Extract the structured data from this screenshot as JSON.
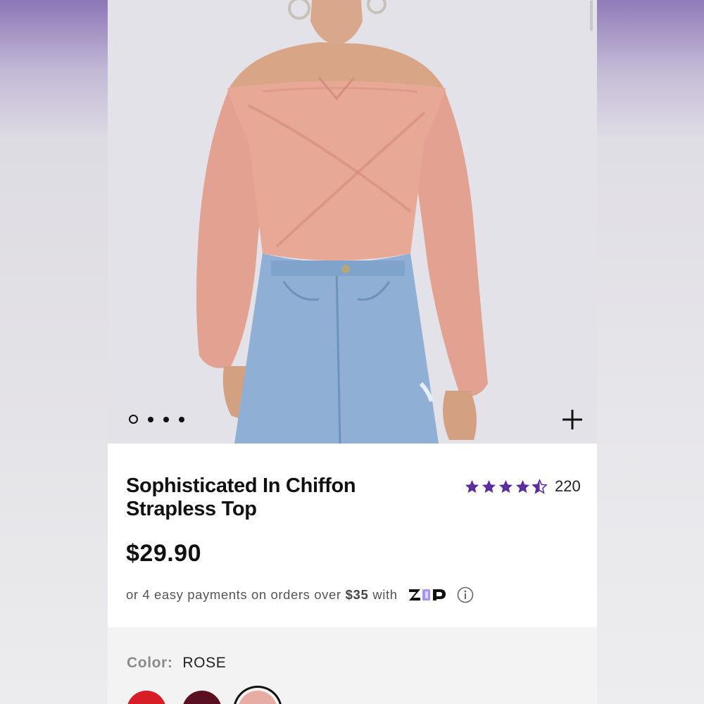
{
  "product": {
    "title": "Sophisticated In Chiffon Strapless Top",
    "rating": {
      "stars": 4.5,
      "max_stars": 5,
      "count": "220",
      "star_color": "#5a2e9c"
    },
    "price": "$29.90",
    "payments": {
      "text_before": "or 4 easy payments on orders over",
      "threshold": "$35",
      "text_after": "with",
      "provider_logo": "ZIP"
    },
    "gallery": {
      "total_images": 4,
      "active_index": 0
    },
    "color": {
      "label": "Color:",
      "selected": "ROSE",
      "swatches": [
        {
          "name": "red",
          "hex": "#d71e26"
        },
        {
          "name": "burgundy",
          "hex": "#5a1020"
        },
        {
          "name": "rose",
          "hex": "#e7aca3",
          "selected": true
        }
      ]
    }
  },
  "icons": {
    "zoom": "plus-icon",
    "info": "info-icon"
  }
}
